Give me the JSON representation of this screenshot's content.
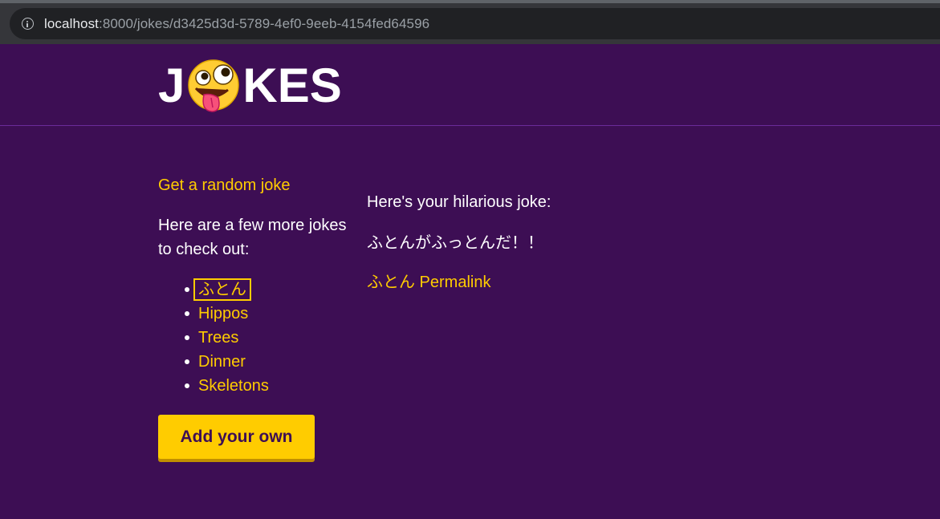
{
  "browser": {
    "url_host": "localhost",
    "url_path": ":8000/jokes/d3425d3d-5789-4ef0-9eeb-4154fed64596"
  },
  "header": {
    "logo_left": "J",
    "logo_emoji": "zany-face-emoji",
    "logo_right": "KES"
  },
  "sidebar": {
    "random_link": "Get a random joke",
    "more_text": "Here are a few more jokes to check out:",
    "jokes": [
      "ふとん",
      "Hippos",
      "Trees",
      "Dinner",
      "Skeletons"
    ],
    "add_button": "Add your own"
  },
  "main": {
    "intro": "Here's your hilarious joke:",
    "content": "ふとんがふっとんだ！！",
    "permalink": "ふとん Permalink"
  },
  "colors": {
    "background": "#3d0e54",
    "accent": "#ffcc00",
    "text": "#ffffff"
  }
}
